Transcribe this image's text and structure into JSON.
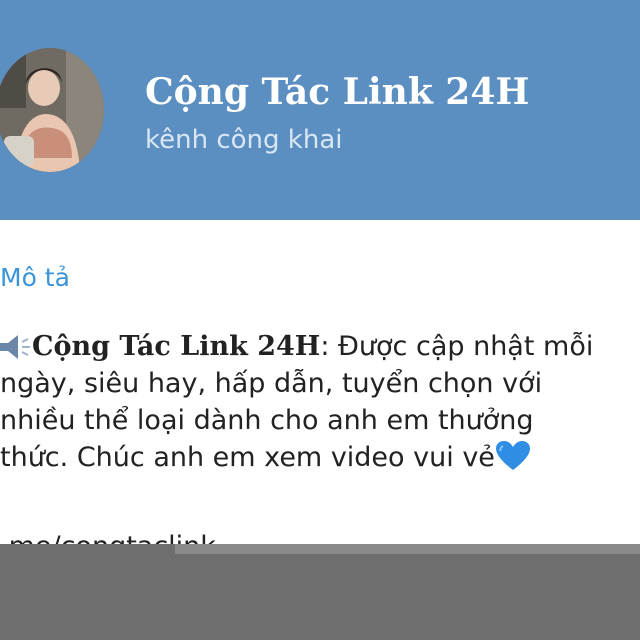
{
  "header": {
    "title": "Cộng Tác Link 24H",
    "subtitle": "kênh công khai",
    "background": "#5b8fc1"
  },
  "description": {
    "label": "Mô tả",
    "name": "Cộng Tác Link 24H",
    "line1_rest": ": Được cập nhật mỗi",
    "line2": "ngày, siêu hay, hấp dẫn, tuyển chọn với",
    "line3": "nhiều thể loại dành cho anh em thưởng",
    "line4": "thức. Chúc anh em xem video vui vẻ",
    "lead_icon": "loudspeaker-icon",
    "trail_icon": "blue-heart-icon"
  },
  "link": {
    "text": ".me/congtaclink"
  },
  "colors": {
    "accent": "#3b94d8",
    "text": "#222222",
    "overlay": "#6e6e6e"
  }
}
